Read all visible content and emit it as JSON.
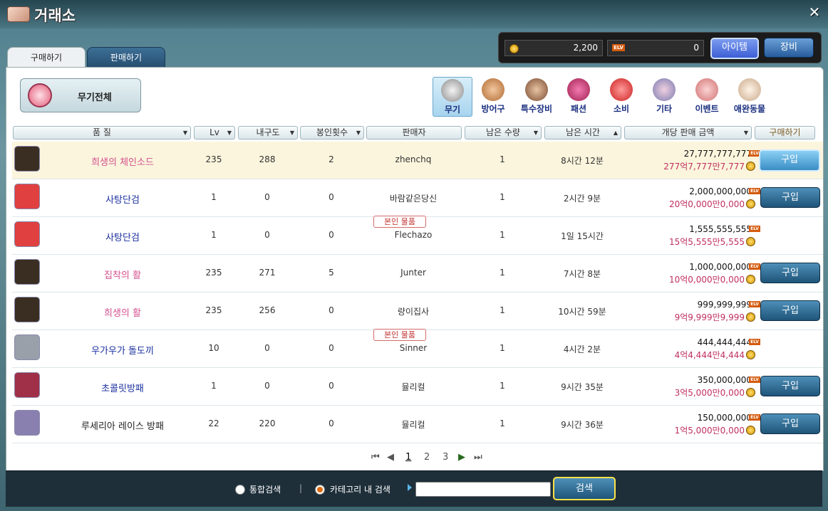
{
  "window": {
    "title": "거래소",
    "close": "✕"
  },
  "currency": {
    "meso": "2,200",
    "elv": "0",
    "elv_label": "ELV",
    "btn_item": "아이템",
    "btn_equip": "장비"
  },
  "tabs": {
    "buy": "구매하기",
    "sell": "판매하기"
  },
  "all_weapons": "무기전체",
  "categories": [
    "무기",
    "방어구",
    "특수장비",
    "패션",
    "소비",
    "기타",
    "이벤트",
    "애완동물"
  ],
  "headers": {
    "quality": "품 질",
    "lv": "Lv",
    "durability": "내구도",
    "seal": "봉인횟수",
    "seller": "판매자",
    "qty": "남은 수량",
    "time": "남은 시간",
    "price": "개당 판매 금액",
    "buy": "구매하기"
  },
  "own_item": "본인 물품",
  "buy_label": "구입",
  "rows": [
    {
      "name": "희생의 체인소드",
      "lv": "235",
      "dur": "288",
      "seal": "2",
      "seller": "zhenchq",
      "qty": "1",
      "time": "8시간 12분",
      "price": "27,777,777,777",
      "price_sub": "277억7,777만7,777",
      "name_color": "#d4508e",
      "icon_color": "#3a2e22",
      "own": false,
      "buy": true
    },
    {
      "name": "사탕단검",
      "lv": "1",
      "dur": "0",
      "seal": "0",
      "seller": "바람같은당신",
      "qty": "1",
      "time": "2시간 9분",
      "price": "2,000,000,000",
      "price_sub": "20억0,000만0,000",
      "name_color": "#1a2f9e",
      "icon_color": "#e04040",
      "own": false,
      "buy": true
    },
    {
      "name": "사탕단검",
      "lv": "1",
      "dur": "0",
      "seal": "0",
      "seller": "Flechazo",
      "qty": "1",
      "time": "1일 15시간",
      "price": "1,555,555,555",
      "price_sub": "15억5,555만5,555",
      "name_color": "#1a2f9e",
      "icon_color": "#e04040",
      "own": true,
      "buy": false
    },
    {
      "name": "집착의 활",
      "lv": "235",
      "dur": "271",
      "seal": "5",
      "seller": "Junter",
      "qty": "1",
      "time": "7시간 8분",
      "price": "1,000,000,000",
      "price_sub": "10억0,000만0,000",
      "name_color": "#d4508e",
      "icon_color": "#3a2e22",
      "own": false,
      "buy": true
    },
    {
      "name": "희생의 활",
      "lv": "235",
      "dur": "256",
      "seal": "0",
      "seller": "량이집사",
      "qty": "1",
      "time": "10시간 59분",
      "price": "999,999,999",
      "price_sub": "9억9,999만9,999",
      "name_color": "#d4508e",
      "icon_color": "#3a2e22",
      "own": false,
      "buy": true
    },
    {
      "name": "우가우가 돌도끼",
      "lv": "10",
      "dur": "0",
      "seal": "0",
      "seller": "Sinner",
      "qty": "1",
      "time": "4시간 2분",
      "price": "444,444,444",
      "price_sub": "4억4,444만4,444",
      "name_color": "#1a2f9e",
      "icon_color": "#9aa0aa",
      "own": true,
      "buy": false
    },
    {
      "name": "초콜릿방패",
      "lv": "1",
      "dur": "0",
      "seal": "0",
      "seller": "뮬리컬",
      "qty": "1",
      "time": "9시간 35분",
      "price": "350,000,000",
      "price_sub": "3억5,000만0,000",
      "name_color": "#1a2f9e",
      "icon_color": "#a03048",
      "own": false,
      "buy": true
    },
    {
      "name": "루세리아 레이스 방패",
      "lv": "22",
      "dur": "220",
      "seal": "0",
      "seller": "뮬리컬",
      "qty": "1",
      "time": "9시간 36분",
      "price": "150,000,000",
      "price_sub": "1억5,000만0,000",
      "name_color": "#222222",
      "icon_color": "#8a80b0",
      "own": false,
      "buy": true
    }
  ],
  "pager": {
    "pages": [
      "1",
      "2",
      "3"
    ],
    "current": "1"
  },
  "search": {
    "opt_all": "통합검색",
    "opt_category": "카테고리 내 검색",
    "separator": "|",
    "input_value": "",
    "btn": "검색"
  }
}
